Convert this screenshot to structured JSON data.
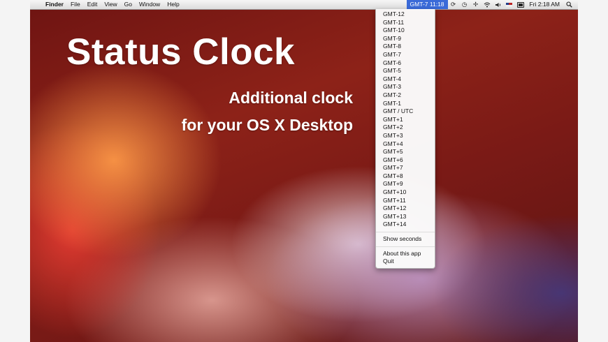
{
  "menubar": {
    "apple": "",
    "items": [
      "Finder",
      "File",
      "Edit",
      "View",
      "Go",
      "Window",
      "Help"
    ],
    "clock": "GMT-7 11:18",
    "icons": [
      "sync-icon",
      "time-machine-icon",
      "bluetooth-icon",
      "wifi-icon",
      "volume-icon",
      "flag-icon",
      "battery-icon"
    ],
    "sync_glyph": "⟳",
    "timemachine_glyph": "◷",
    "bluetooth_glyph": "✢",
    "wifi_glyph": "◜",
    "volume_glyph": "◀)",
    "datetime": "Fri 2:18 AM",
    "search_glyph": "⌕"
  },
  "hero": {
    "title": "Status Clock",
    "subtitle_line1": "Additional clock",
    "subtitle_line2": "for your OS X Desktop"
  },
  "dropdown": {
    "timezones": [
      "GMT-12",
      "GMT-11",
      "GMT-10",
      "GMT-9",
      "GMT-8",
      "GMT-7",
      "GMT-6",
      "GMT-5",
      "GMT-4",
      "GMT-3",
      "GMT-2",
      "GMT-1",
      "GMT / UTC",
      "GMT+1",
      "GMT+2",
      "GMT+3",
      "GMT+4",
      "GMT+5",
      "GMT+6",
      "GMT+7",
      "GMT+8",
      "GMT+9",
      "GMT+10",
      "GMT+11",
      "GMT+12",
      "GMT+13",
      "GMT+14"
    ],
    "show_seconds": "Show seconds",
    "about": "About this app",
    "quit": "Quit"
  },
  "colors": {
    "menu_highlight": "#3a6ad8",
    "wallpaper_red": "#8d2218"
  }
}
